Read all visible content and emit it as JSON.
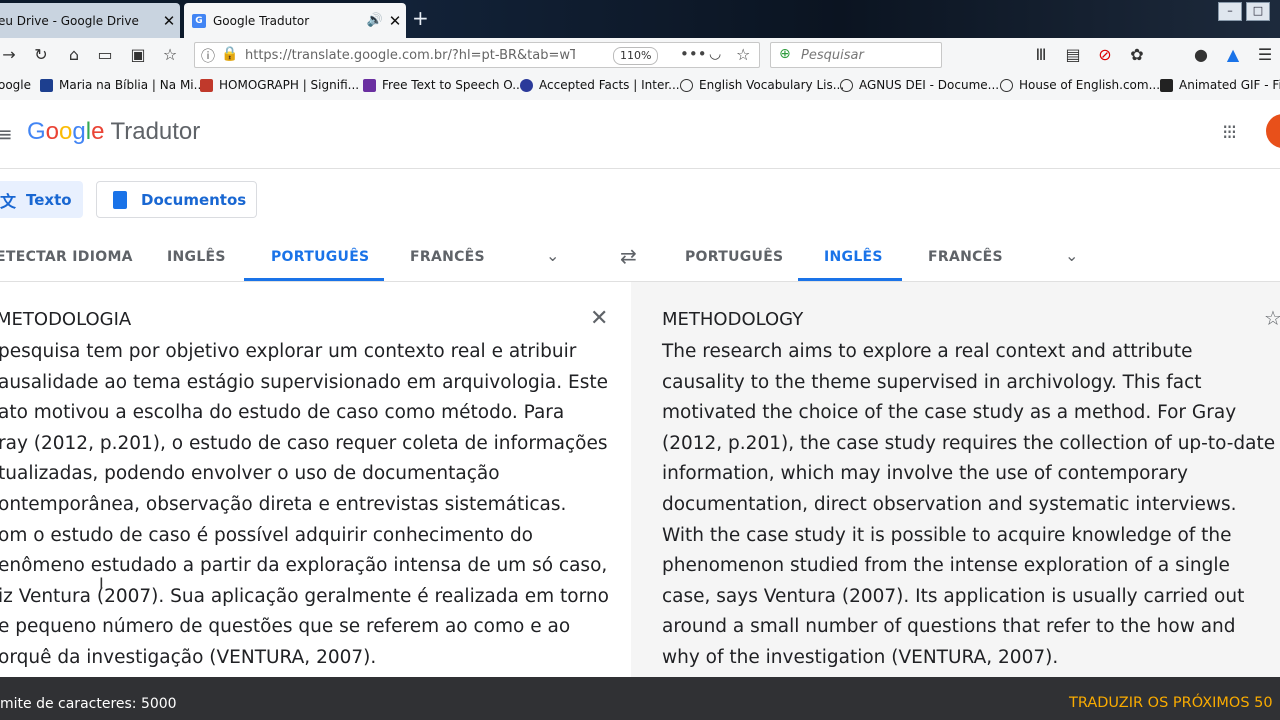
{
  "browser": {
    "tabs": [
      {
        "title": "eu Drive - Google Drive"
      },
      {
        "title": "Google Tradutor"
      }
    ],
    "url": "https://translate.google.com.br/?hl=pt-BR&tab=wT&a",
    "zoom": "110%",
    "search_placeholder": "Pesquisar",
    "bookmarks": [
      "oogle",
      "Maria na Bíblia | Na Mi...",
      "HOMOGRAPH | Signifi...",
      "Free Text to Speech O...",
      "Accepted Facts | Inter...",
      "English Vocabulary Lis...",
      "AGNUS DEI - Docume...",
      "House of English.com....",
      "Animated GIF - Fin"
    ]
  },
  "app": {
    "logo": "Google",
    "product": "Tradutor",
    "modes": {
      "text": "Texto",
      "documents": "Documentos"
    },
    "source_langs": [
      "ETECTAR IDIOMA",
      "INGLÊS",
      "PORTUGUÊS",
      "FRANCÊS"
    ],
    "target_langs": [
      "PORTUGUÊS",
      "INGLÊS",
      "FRANCÊS"
    ],
    "source": {
      "heading": "METODOLOGIA",
      "lines": [
        "pesquisa tem por objetivo explorar um contexto real e atribuir",
        "ausalidade ao tema estágio supervisionado em arquivologia. Este",
        "ato motivou a escolha do estudo de caso como método. Para",
        "ray (2012, p.201), o estudo de caso requer coleta de informações",
        "tualizadas, podendo envolver o uso de documentação",
        "ontemporânea, observação direta e entrevistas sistemáticas.",
        "om o estudo de caso é possível adquirir conhecimento do",
        "enômeno estudado a partir da exploração intensa de um só caso,",
        "iz Ventura (2007). Sua aplicação geralmente é realizada em torno",
        "e pequeno número de questões que se referem ao como e ao",
        "orquê da investigação (VENTURA, 2007)."
      ]
    },
    "target": {
      "heading": "METHODOLOGY",
      "lines": [
        "The research aims to explore a real context and attribute",
        "causality to the theme supervised in archivology. This fact",
        "motivated the choice of the case study as a method. For Gray",
        "(2012, p.201), the case study requires the collection of up-to-date",
        "information, which may involve the use of contemporary",
        "documentation, direct observation and systematic interviews.",
        "With the case study it is possible to acquire knowledge of the",
        "phenomenon studied from the intense exploration of a single",
        "case, says Ventura (2007). Its application is usually carried out",
        "around a small number of questions that refer to the how and",
        "why of the investigation (VENTURA, 2007)."
      ]
    },
    "footer": {
      "char_limit": "mite de caracteres: 5000",
      "next_button": "TRADUZIR OS PRÓXIMOS 50"
    }
  }
}
